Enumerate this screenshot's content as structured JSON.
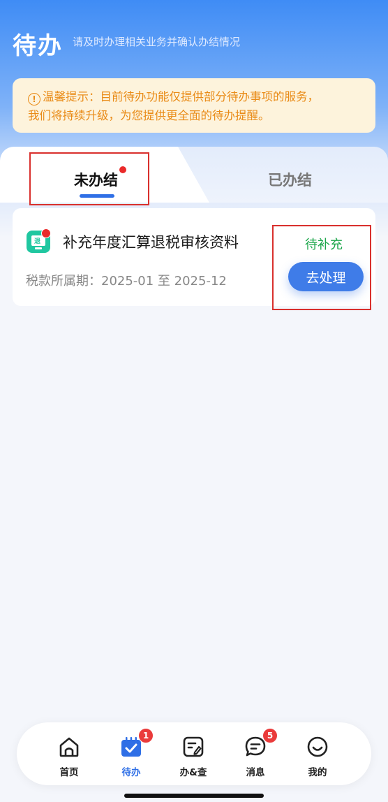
{
  "header": {
    "title": "待办",
    "subtitle": "请及时办理相关业务并确认办结情况"
  },
  "notice": {
    "icon": "info-circle-icon",
    "text_line1": "温馨提示：目前待办功能仅提供部分待办事项的服务，",
    "text_line2": "我们将持续升级，为您提供更全面的待办提醒。"
  },
  "tabs": [
    {
      "label": "未办结",
      "active": true,
      "has_dot": true
    },
    {
      "label": "已办结",
      "active": false
    }
  ],
  "task": {
    "title": "补充年度汇算退税审核资料",
    "period_label": "税款所属期：",
    "period_value": "2025-01 至 2025-12",
    "status": "待补充",
    "action_label": "去处理",
    "icon_glyph": "退"
  },
  "nav": [
    {
      "label": "首页",
      "icon": "home-icon",
      "active": false
    },
    {
      "label": "待办",
      "icon": "todo-calendar-icon",
      "active": true,
      "badge": "1"
    },
    {
      "label": "办&查",
      "icon": "handle-query-icon",
      "active": false
    },
    {
      "label": "消息",
      "icon": "message-icon",
      "active": false,
      "badge": "5"
    },
    {
      "label": "我的",
      "icon": "smile-icon",
      "active": false
    }
  ],
  "colors": {
    "primary": "#2f6fe6",
    "header_gradient_top": "#3f8cf5",
    "notice_bg": "#fdf3dc",
    "notice_text": "#e98b17",
    "status_green": "#1ba64a",
    "badge_red": "#ea3b3b",
    "highlight_red": "#d9302d"
  }
}
